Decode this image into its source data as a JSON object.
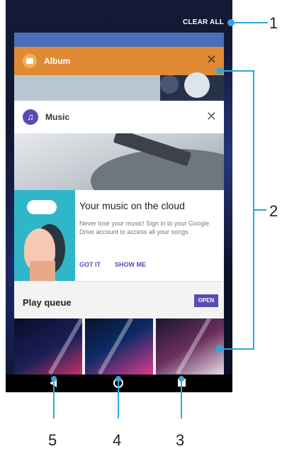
{
  "recents": {
    "clear_all_label": "CLEAR ALL",
    "album_card": {
      "title": "Album",
      "close_glyph": "✕"
    },
    "music_card": {
      "title": "Music",
      "close_glyph": "✕",
      "icon_glyph": "♫",
      "promo": {
        "title": "Your music on the cloud",
        "text": "Never lose your music! Sign in to your Google Drive account to access all your songs",
        "primary_action": "GOT IT",
        "secondary_action": "SHOW ME"
      },
      "play_queue": {
        "title": "Play queue",
        "open_label": "OPEN"
      }
    }
  },
  "nav_bar": {
    "icons": [
      "back-icon",
      "home-icon",
      "overview-icon"
    ]
  },
  "callouts": {
    "c1": "1",
    "c2": "2",
    "c3": "3",
    "c4": "4",
    "c5": "5"
  },
  "colors": {
    "accent": "#5b4bb0",
    "album_header": "#e08a35",
    "callout_line": "#2ea7e0"
  }
}
